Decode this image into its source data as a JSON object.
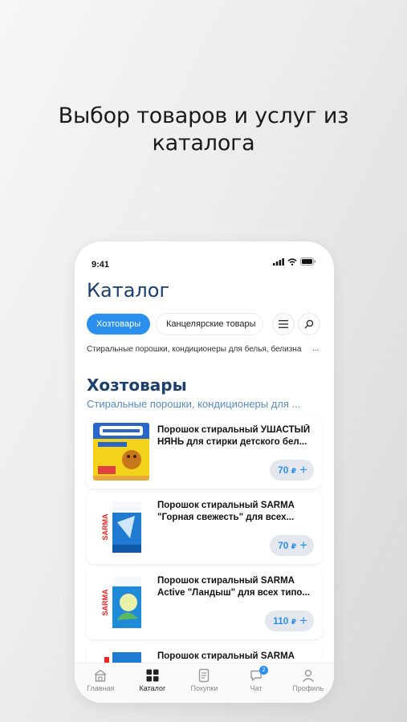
{
  "headline": {
    "line1": "Выбор товаров и услуг из",
    "line2": "каталога"
  },
  "status_bar": {
    "time": "9:41"
  },
  "catalog": {
    "title": "Каталог",
    "chips": [
      {
        "label": "Хозтовары",
        "active": true
      },
      {
        "label": "Канцелярские товары",
        "active": false
      }
    ],
    "subcategories_line": "Стиральные порошки, кондиционеры для белья, белизна",
    "more": "...",
    "section": {
      "title": "Хозтовары",
      "subtitle": "Стиральные порошки, кондиционеры для ..."
    },
    "products": [
      {
        "name": "Порошок стиральный УШАСТЫЙ НЯНЬ для стирки детского бел...",
        "price": "70",
        "currency": "₽",
        "image": "ushasty-nyan-box"
      },
      {
        "name": "Порошок стиральный SARMA \"Горная свежесть\" для всех...",
        "price": "70",
        "currency": "₽",
        "image": "sarma-blue-box"
      },
      {
        "name": "Порошок стиральный SARMA Active \"Ландыш\" для всех типо...",
        "price": "110",
        "currency": "₽",
        "image": "sarma-lily-box"
      },
      {
        "name": "Порошок стиральный SARMA",
        "price": "",
        "currency": "",
        "image": "sarma-box"
      }
    ]
  },
  "tabbar": {
    "items": [
      {
        "label": "Главная",
        "icon": "home-icon"
      },
      {
        "label": "Каталог",
        "icon": "grid-icon",
        "active": true
      },
      {
        "label": "Покупки",
        "icon": "receipt-icon"
      },
      {
        "label": "Чат",
        "icon": "chat-icon",
        "badge": "2"
      },
      {
        "label": "Профиль",
        "icon": "profile-icon"
      }
    ]
  },
  "colors": {
    "accent": "#2b8ff0",
    "title": "#1d3f6b",
    "subtitle": "#5a8bc0",
    "price_bg": "#e4e8ee"
  }
}
